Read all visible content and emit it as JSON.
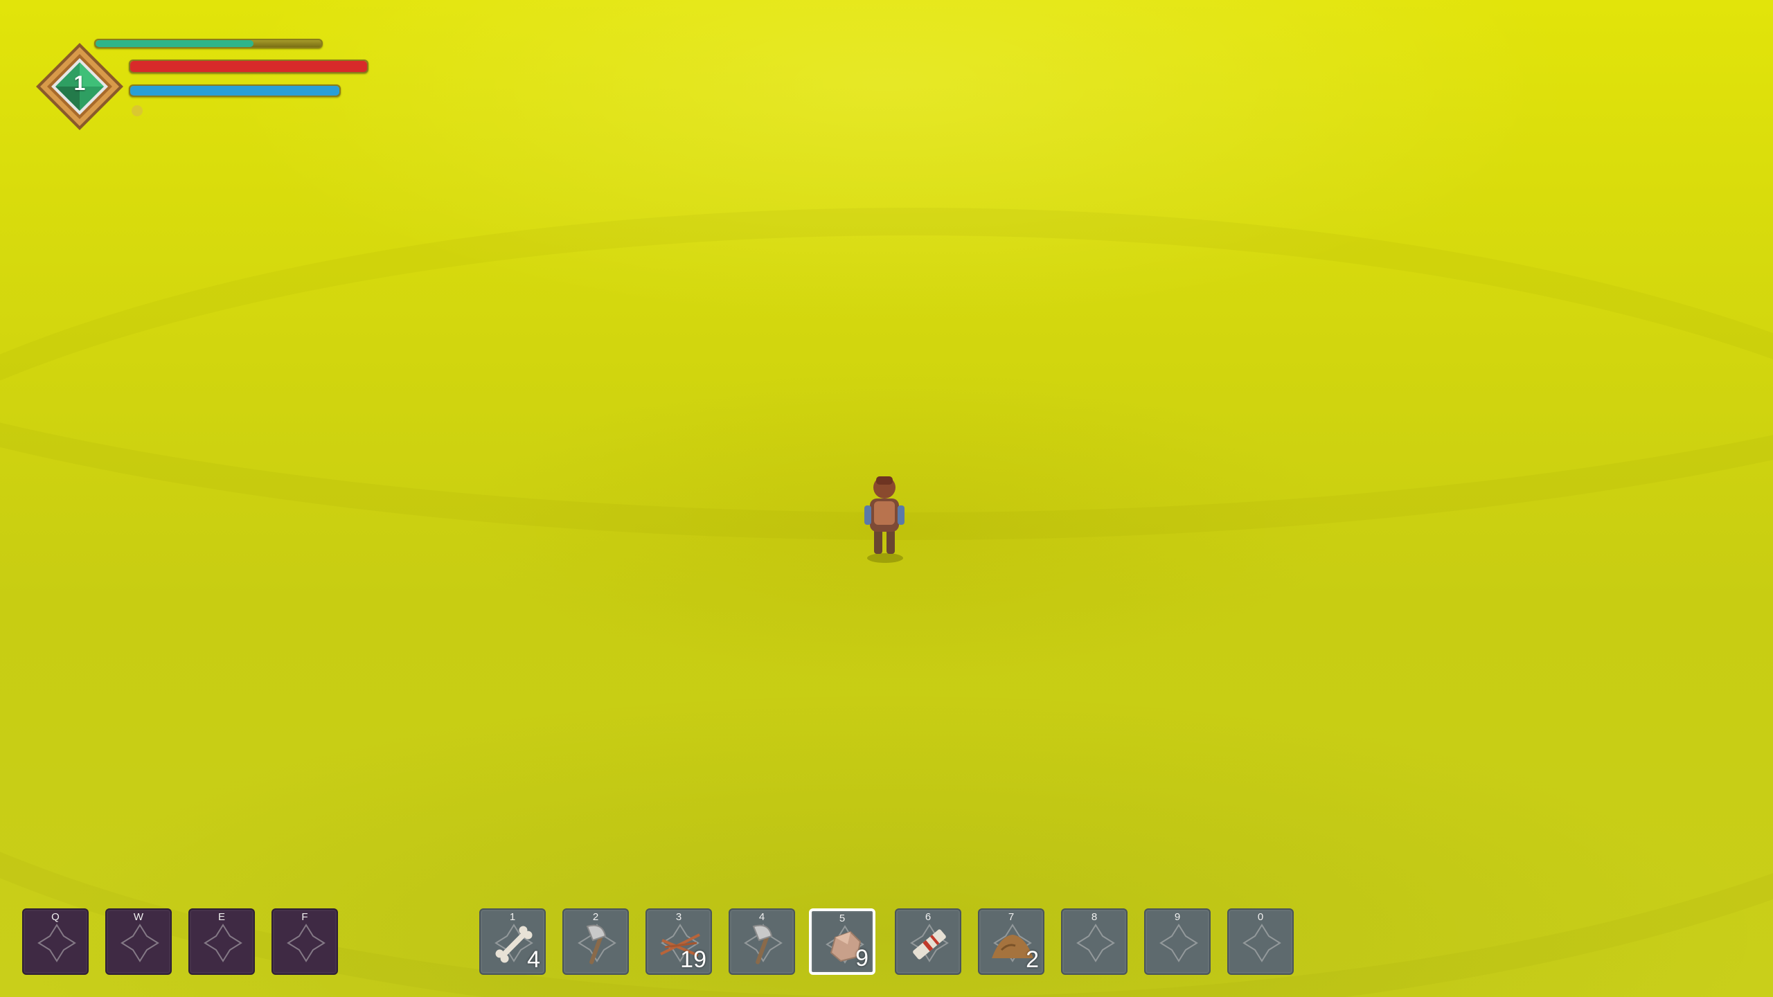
{
  "player": {
    "level": "1",
    "xp_progress": 0.7,
    "health_progress": 1.0,
    "mana_progress": 1.0
  },
  "colors": {
    "xp": "#2fb58a",
    "health": "#d82a2a",
    "mana": "#2a9fd6",
    "grass": "#d2d60e",
    "badge": "#2e9f62"
  },
  "skill_bar": [
    {
      "key": "Q",
      "icon": "empty-slot-icon"
    },
    {
      "key": "W",
      "icon": "empty-slot-icon"
    },
    {
      "key": "E",
      "icon": "empty-slot-icon"
    },
    {
      "key": "F",
      "icon": "empty-slot-icon"
    }
  ],
  "item_bar": [
    {
      "key": "1",
      "icon": "bone-icon",
      "count": "4"
    },
    {
      "key": "2",
      "icon": "axe-icon",
      "count": ""
    },
    {
      "key": "3",
      "icon": "sticks-icon",
      "count": "19"
    },
    {
      "key": "4",
      "icon": "axe-icon",
      "count": ""
    },
    {
      "key": "5",
      "icon": "stone-icon",
      "count": "9",
      "selected": true
    },
    {
      "key": "6",
      "icon": "bandage-icon",
      "count": ""
    },
    {
      "key": "7",
      "icon": "dirt-pile-icon",
      "count": "2"
    },
    {
      "key": "8",
      "icon": "empty-slot-icon",
      "count": ""
    },
    {
      "key": "9",
      "icon": "empty-slot-icon",
      "count": ""
    },
    {
      "key": "0",
      "icon": "empty-slot-icon",
      "count": ""
    }
  ]
}
